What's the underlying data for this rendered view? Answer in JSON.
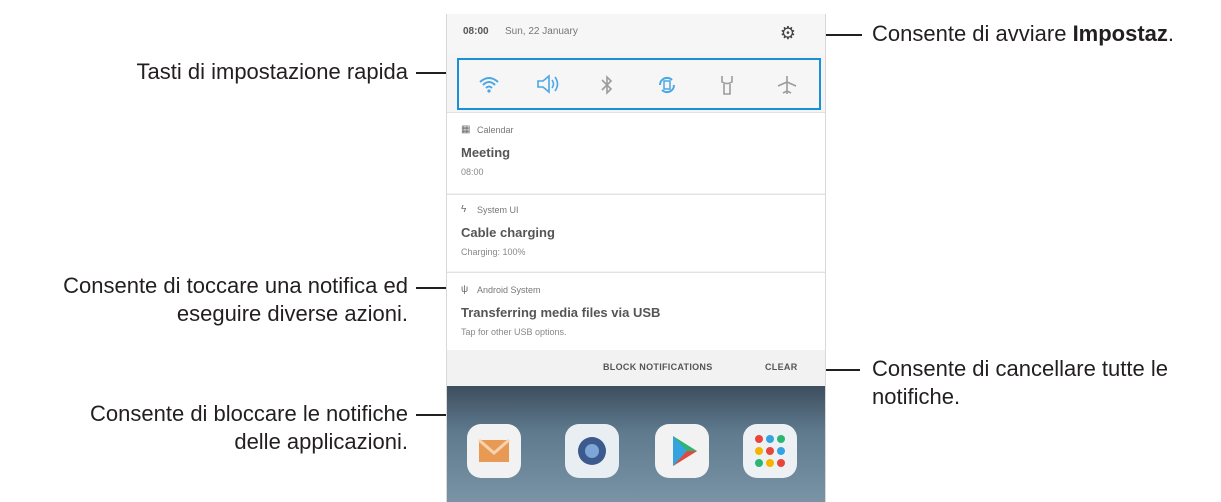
{
  "callouts": {
    "quick_settings": "Tasti di impostazione rapida",
    "settings_prefix": "Consente di avviare ",
    "settings_bold": "Impostaz",
    "settings_suffix": ".",
    "tap_line1": "Consente di toccare una notifica ed",
    "tap_line2": "eseguire diverse azioni.",
    "block_line1": "Consente di bloccare le notifiche",
    "block_line2": "delle applicazioni.",
    "clear_line1": "Consente di cancellare tutte le",
    "clear_line2": "notifiche."
  },
  "phone": {
    "status": {
      "time": "08:00",
      "date": "Sun, 22 January"
    },
    "quick_settings": [
      {
        "icon": "wifi-icon",
        "glyph": "◠",
        "color": "#4aa7e6"
      },
      {
        "icon": "sound-icon",
        "glyph": "◁)",
        "color": "#4aa7e6"
      },
      {
        "icon": "bluetooth-icon",
        "glyph": "ᛒ",
        "color": "#9c9c9c"
      },
      {
        "icon": "auto-rotate-icon",
        "glyph": "⟲",
        "color": "#4aa7e6"
      },
      {
        "icon": "flashlight-icon",
        "glyph": "♆",
        "color": "#9c9c9c"
      },
      {
        "icon": "airplane-icon",
        "glyph": "✈",
        "color": "#9c9c9c"
      }
    ],
    "notifications": [
      {
        "app": "Calendar",
        "title": "Meeting",
        "sub": "08:00"
      },
      {
        "app": "System UI",
        "title": "Cable charging",
        "sub": "Charging: 100%"
      },
      {
        "app": "Android System",
        "title": "Transferring media files via USB",
        "sub": "Tap for other USB options."
      }
    ],
    "actions": {
      "block": "BLOCK NOTIFICATIONS",
      "clear": "CLEAR"
    }
  }
}
